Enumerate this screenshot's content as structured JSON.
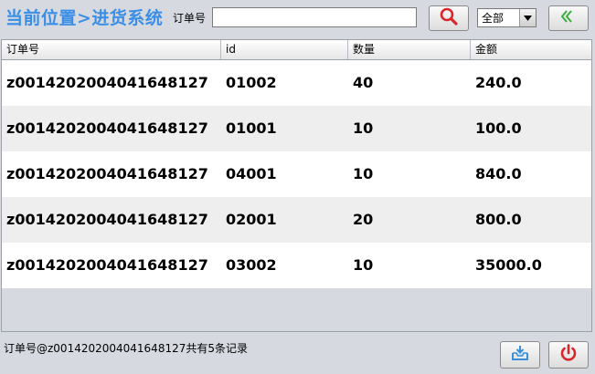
{
  "header": {
    "breadcrumb": "当前位置>进货系统",
    "order_label": "订单号",
    "search_value": "",
    "filter_selected": "全部"
  },
  "icons": {
    "search": "search-icon",
    "back": "chevron-left-icon",
    "export": "export-tray-icon",
    "power": "power-icon",
    "dropdown": "chevron-down-icon"
  },
  "colors": {
    "breadcrumb": "#3a8ee6",
    "search_icon": "#d9262a",
    "back_icon": "#3cae3c",
    "power_icon": "#d9262a",
    "export_icon": "#3b8fd8"
  },
  "table": {
    "columns": [
      "订单号",
      "id",
      "数量",
      "金额"
    ],
    "rows": [
      [
        "z0014202004041648127",
        "01002",
        "40",
        "240.0"
      ],
      [
        "z0014202004041648127",
        "01001",
        "10",
        "100.0"
      ],
      [
        "z0014202004041648127",
        "04001",
        "10",
        "840.0"
      ],
      [
        "z0014202004041648127",
        "02001",
        "20",
        "800.0"
      ],
      [
        "z0014202004041648127",
        "03002",
        "10",
        "35000.0"
      ]
    ]
  },
  "footer": {
    "status": "订单号@z0014202004041648127共有5条记录"
  }
}
